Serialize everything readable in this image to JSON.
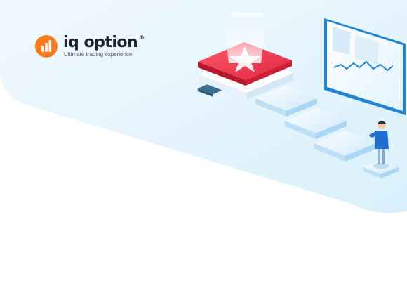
{
  "brand": {
    "name": "iq option",
    "registered": "®",
    "tagline": "Ultimate trading experience",
    "accent_color": "#ff7a1c",
    "text_color": "#1c2230"
  },
  "illustration": {
    "icons": [
      "star-icon",
      "chart-monitor-icon",
      "person-figure"
    ],
    "primary_color": "#e8334a",
    "secondary_color": "#2f8bd9",
    "background_color": "#e6f5fd"
  }
}
